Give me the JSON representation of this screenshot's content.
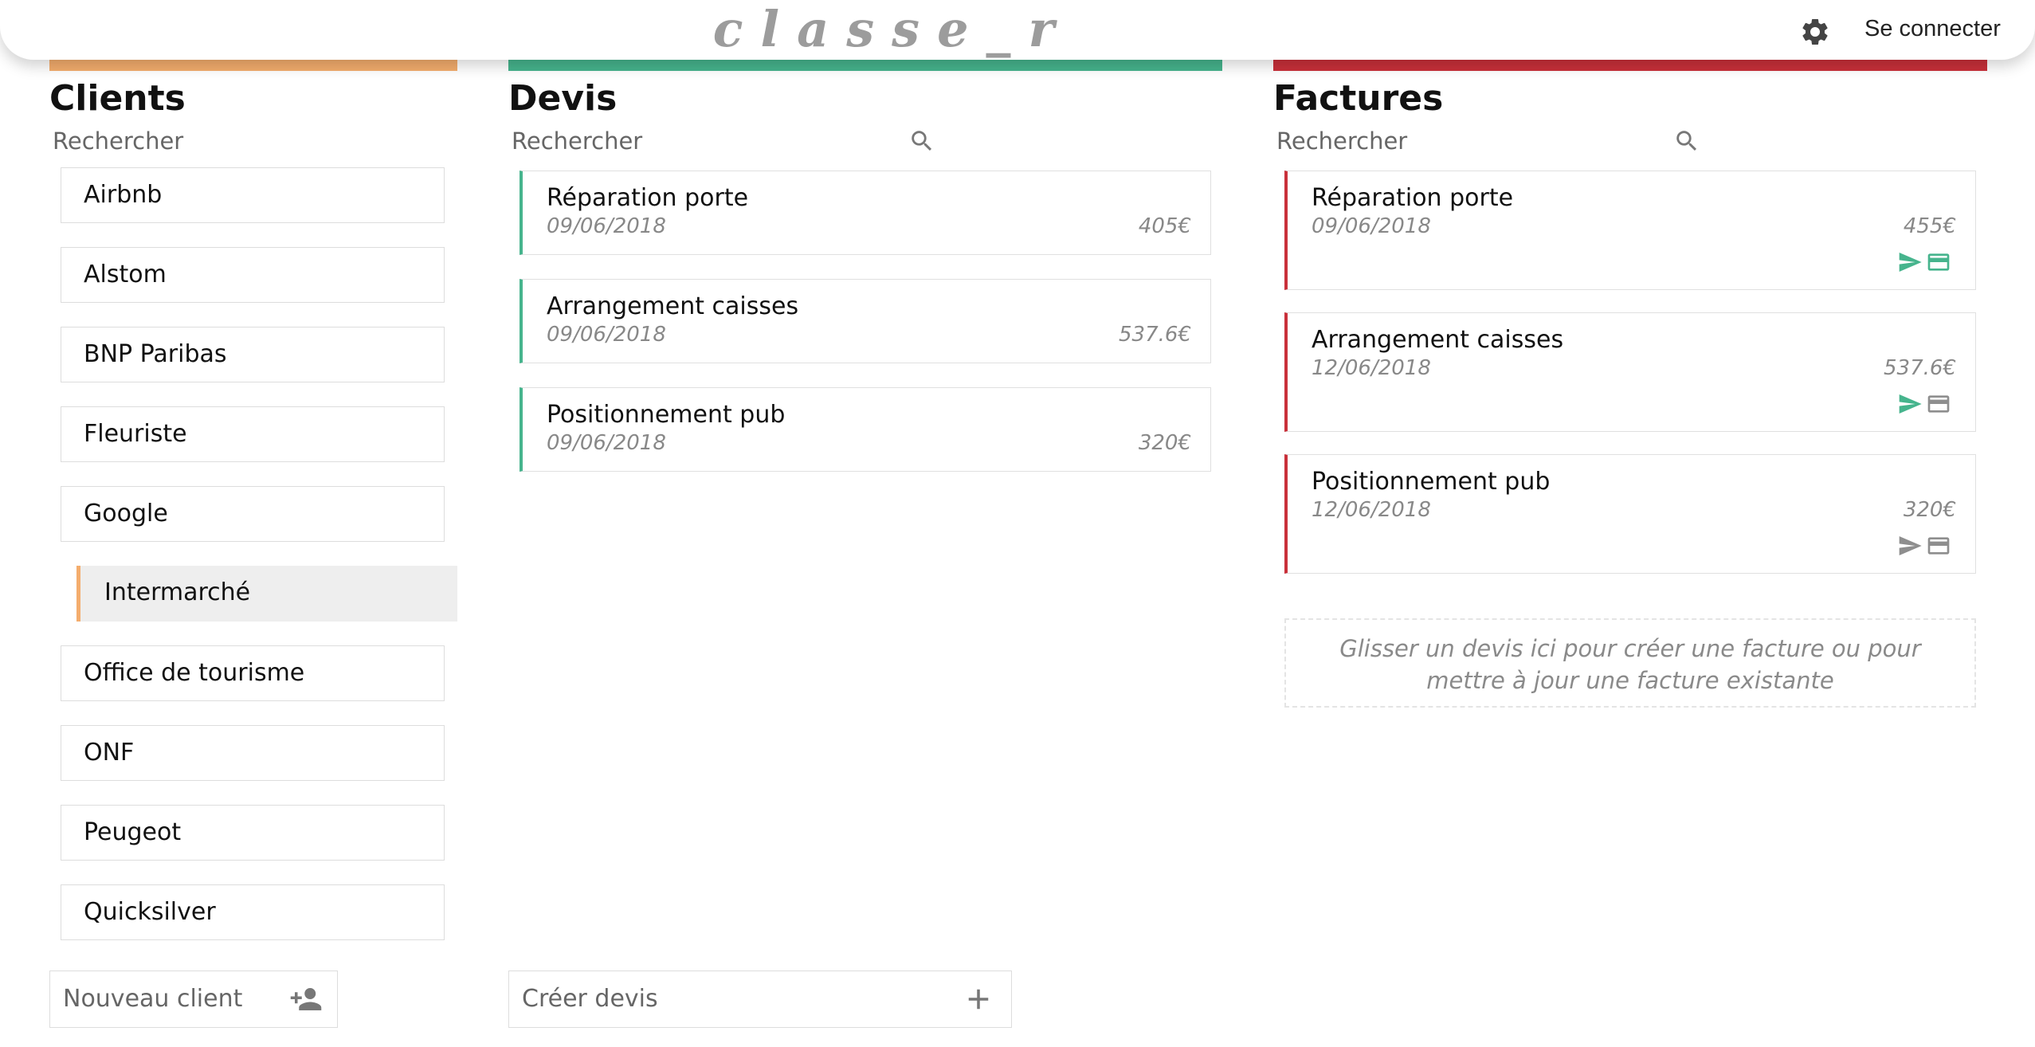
{
  "header": {
    "brand": "classe_r",
    "login_label": "Se connecter"
  },
  "colors": {
    "clients": "#f4ad6d",
    "devis": "#46b48d",
    "factures": "#c9303a",
    "icon_active": "#46b48d",
    "icon_inactive": "#8e8e8e"
  },
  "clients": {
    "title": "Clients",
    "search_placeholder": "Rechercher",
    "items": [
      {
        "label": "Airbnb"
      },
      {
        "label": "Alstom"
      },
      {
        "label": "BNP Paribas"
      },
      {
        "label": "Fleuriste"
      },
      {
        "label": "Google"
      },
      {
        "label": "Intermarché",
        "selected": true
      },
      {
        "label": "Office de tourisme"
      },
      {
        "label": "ONF"
      },
      {
        "label": "Peugeot"
      },
      {
        "label": "Quicksilver"
      }
    ],
    "new_label": "Nouveau client"
  },
  "devis": {
    "title": "Devis",
    "search_placeholder": "Rechercher",
    "items": [
      {
        "name": "Réparation porte",
        "date": "09/06/2018",
        "amount": "405€"
      },
      {
        "name": "Arrangement caisses",
        "date": "09/06/2018",
        "amount": "537.6€"
      },
      {
        "name": "Positionnement pub",
        "date": "09/06/2018",
        "amount": "320€"
      }
    ],
    "create_label": "Créer devis"
  },
  "factures": {
    "title": "Factures",
    "search_placeholder": "Rechercher",
    "items": [
      {
        "name": "Réparation porte",
        "date": "09/06/2018",
        "amount": "455€",
        "sent": true,
        "paid": true
      },
      {
        "name": "Arrangement caisses",
        "date": "12/06/2018",
        "amount": "537.6€",
        "sent": true,
        "paid": false
      },
      {
        "name": "Positionnement pub",
        "date": "12/06/2018",
        "amount": "320€",
        "sent": false,
        "paid": false
      }
    ],
    "dropzone_text": "Glisser un devis ici pour créer une facture ou pour mettre à jour une facture existante"
  }
}
